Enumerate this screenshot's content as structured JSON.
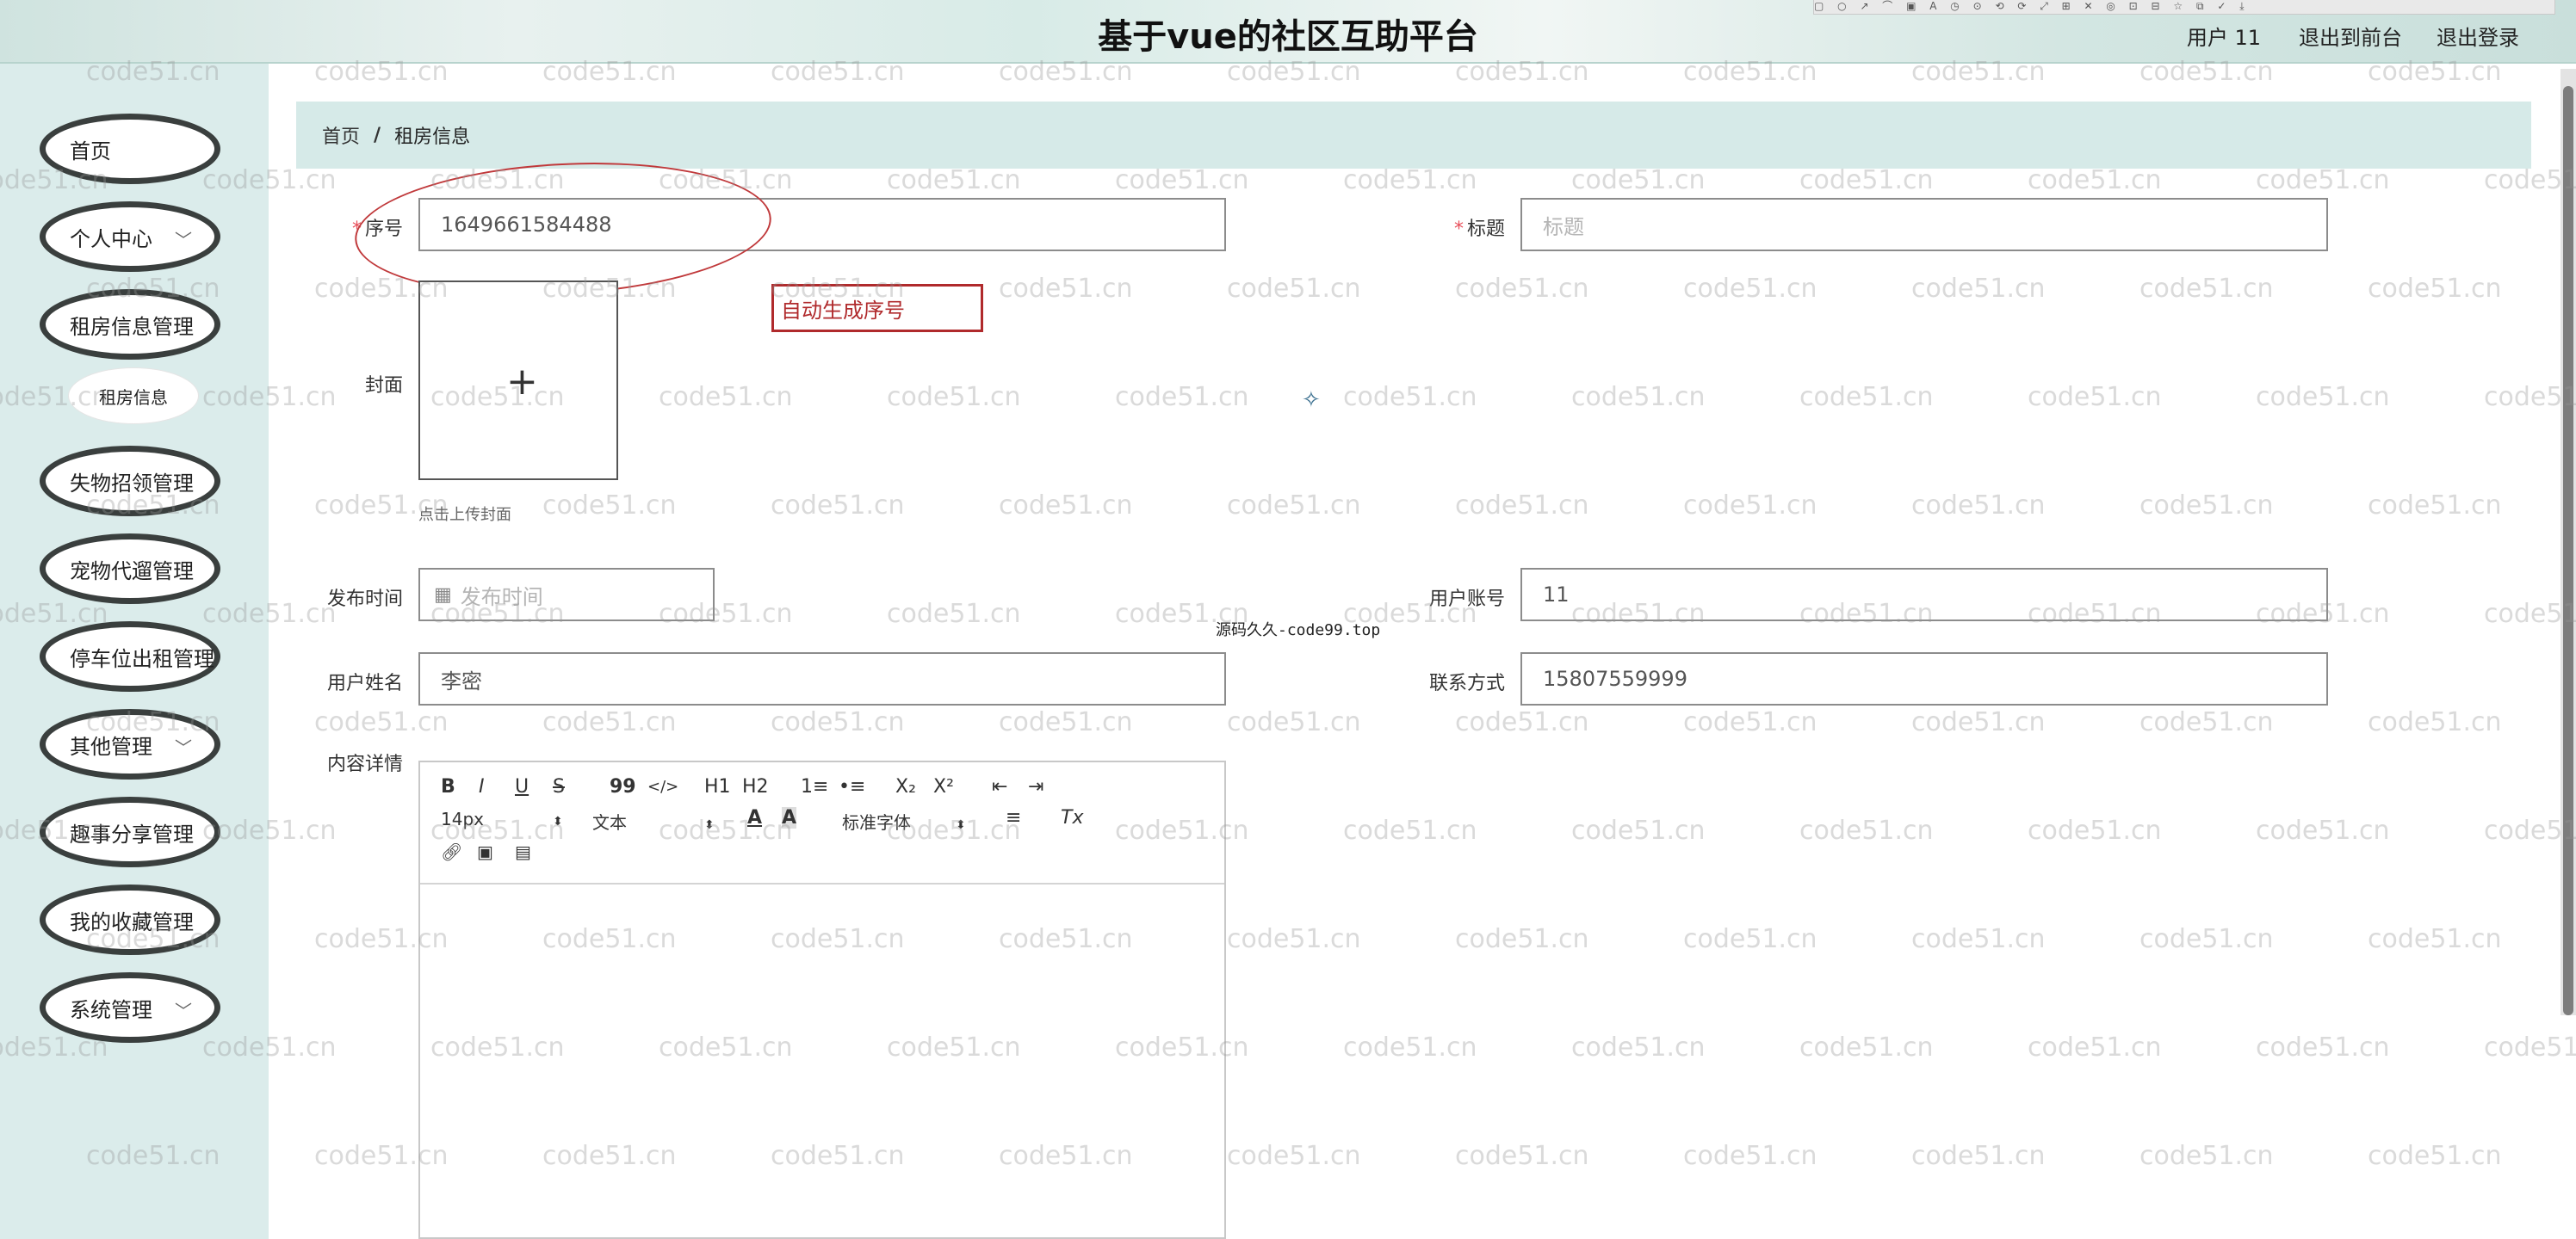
{
  "header": {
    "title": "基于vue的社区互助平台",
    "user": "用户 11",
    "back_to_front": "退出到前台",
    "logout": "退出登录"
  },
  "sidebar": {
    "items": [
      {
        "label": "首页",
        "has_arrow": false
      },
      {
        "label": "个人中心",
        "has_arrow": true
      },
      {
        "label": "租房信息管理",
        "has_arrow": false
      },
      {
        "label": "失物招领管理",
        "has_arrow": false
      },
      {
        "label": "宠物代遛管理",
        "has_arrow": false
      },
      {
        "label": "停车位出租管理",
        "has_arrow": false
      },
      {
        "label": "其他管理",
        "has_arrow": true
      },
      {
        "label": "趣事分享管理",
        "has_arrow": false
      },
      {
        "label": "我的收藏管理",
        "has_arrow": false
      },
      {
        "label": "系统管理",
        "has_arrow": true
      }
    ],
    "sub_item": "租房信息",
    "arrow_icon": "chevron-down-icon"
  },
  "breadcrumb": {
    "home": "首页",
    "separator": "/",
    "current": "租房信息"
  },
  "form": {
    "serial": {
      "label": "序号",
      "value": "1649661584488"
    },
    "title": {
      "label": "标题",
      "placeholder": "标题"
    },
    "cover": {
      "label": "封面",
      "tip": "点击上传封面"
    },
    "publish_time": {
      "label": "发布时间",
      "placeholder": "发布时间"
    },
    "user_account": {
      "label": "用户账号",
      "value": "11"
    },
    "user_name": {
      "label": "用户姓名",
      "value": "李密"
    },
    "contact": {
      "label": "联系方式",
      "value": "15807559999"
    },
    "content": {
      "label": "内容详情"
    }
  },
  "annotation": {
    "text": "自动生成序号"
  },
  "overlay_text": "源码久久-code99.top",
  "watermark": "code51.cn",
  "editor": {
    "font_size": "14px",
    "block_format": "文本",
    "font_family": "标准字体",
    "buttons": {
      "bold": "B",
      "italic": "I",
      "underline": "U",
      "strike": "S",
      "quote": "99",
      "code": "</>",
      "h1": "H1",
      "h2": "H2",
      "ol": "1≡",
      "ul": "•≡",
      "sub": "X₂",
      "sup": "X²",
      "indent_out": "⇤",
      "indent_in": "⇥",
      "color": "A",
      "bg": "A",
      "align": "≡",
      "clean": "Tx"
    }
  },
  "colors": {
    "accent": "#d6eae8",
    "required": "#e8505b",
    "annotation": "#b02a2c",
    "border": "#3a3f3e"
  }
}
